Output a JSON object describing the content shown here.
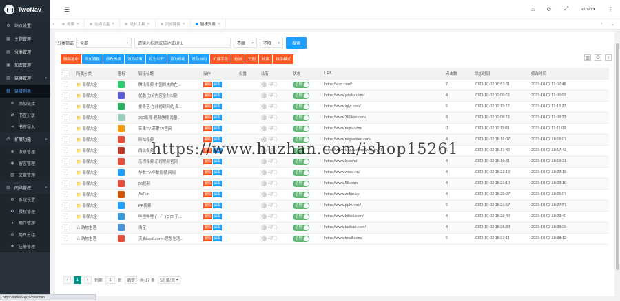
{
  "app": {
    "name": "TwoNav"
  },
  "sidebar": {
    "items": [
      {
        "label": "站点设置",
        "icon": "gear-icon",
        "kind": "group",
        "glyph": "⚙"
      },
      {
        "label": "主题管理",
        "icon": "theme-icon",
        "kind": "group",
        "glyph": "▦"
      },
      {
        "label": "分类管理",
        "icon": "category-icon",
        "kind": "group",
        "glyph": "▤"
      },
      {
        "label": "加密管理",
        "icon": "lock-icon",
        "kind": "group",
        "glyph": "▣"
      },
      {
        "label": "链接管理",
        "icon": "link-icon",
        "kind": "group",
        "glyph": "▥",
        "caret": true
      },
      {
        "label": "链接列表",
        "icon": "list-icon",
        "kind": "active",
        "glyph": "⛓"
      },
      {
        "label": "添加链接",
        "icon": "plus-icon",
        "kind": "sub",
        "glyph": "⊕"
      },
      {
        "label": "书签分享",
        "icon": "share-icon",
        "kind": "sub",
        "glyph": "⇄"
      },
      {
        "label": "书签导入",
        "icon": "import-icon",
        "kind": "sub",
        "glyph": "⇥"
      },
      {
        "label": "扩展功能",
        "icon": "extension-icon",
        "kind": "group",
        "glyph": "☍",
        "caret": true
      },
      {
        "label": "收录管理",
        "icon": "collect-icon",
        "kind": "sub",
        "glyph": "◈"
      },
      {
        "label": "留言管理",
        "icon": "message-icon",
        "kind": "sub",
        "glyph": "◉"
      },
      {
        "label": "文章管理",
        "icon": "article-icon",
        "kind": "sub",
        "glyph": "▧"
      },
      {
        "label": "网站管理",
        "icon": "website-icon",
        "kind": "group",
        "glyph": "▨",
        "caret": true
      },
      {
        "label": "系统设置",
        "icon": "settings-icon",
        "kind": "sub",
        "glyph": "⚙"
      },
      {
        "label": "授权管理",
        "icon": "license-icon",
        "kind": "sub",
        "glyph": "✪"
      },
      {
        "label": "用户管理",
        "icon": "user-icon",
        "kind": "sub",
        "glyph": "●"
      },
      {
        "label": "用户分组",
        "icon": "group-icon",
        "kind": "sub",
        "glyph": "◍"
      },
      {
        "label": "注册管理",
        "icon": "register-icon",
        "kind": "sub",
        "glyph": "✚"
      }
    ]
  },
  "topbar": {
    "user": "admin"
  },
  "tabs": [
    {
      "label": "概要",
      "active": false
    },
    {
      "label": "站点设置",
      "active": false
    },
    {
      "label": "站长工具",
      "active": false
    },
    {
      "label": "添加链接",
      "active": false
    },
    {
      "label": "链接列表",
      "active": true
    }
  ],
  "filter": {
    "category_label": "分类筛选",
    "category_value": "全部",
    "search_placeholder": "请输入标题或描述或URL",
    "select2": "不限",
    "select3": "不限",
    "search_button": "搜索"
  },
  "toolbar": [
    {
      "label": "删除选中",
      "color": "red"
    },
    {
      "label": "添加链接",
      "color": "blue"
    },
    {
      "label": "修改分类",
      "color": "blue"
    },
    {
      "label": "设为私有",
      "color": "blue"
    },
    {
      "label": "设为公开",
      "color": "blue"
    },
    {
      "label": "设为停用",
      "color": "blue"
    },
    {
      "label": "设为启用",
      "color": "blue"
    },
    {
      "label": "扩展字段",
      "color": "red"
    },
    {
      "label": "检测",
      "color": "red"
    },
    {
      "label": "识别",
      "color": "red"
    },
    {
      "label": "排序",
      "color": "red"
    },
    {
      "label": "排序模式",
      "color": "red"
    }
  ],
  "table": {
    "headers": [
      "",
      "所属分类",
      "图标",
      "链接标题",
      "操作",
      "权重",
      "私有",
      "状态",
      "URL",
      "点击数",
      "添加时间",
      "修改时间"
    ],
    "delete_label": "删除",
    "edit_label": "编辑",
    "private_label": "公开",
    "status_label": "启用",
    "rows": [
      {
        "category": "影视大全",
        "cat_icon": "📁",
        "fav": "#2ecc71",
        "title": "腾讯视频-中国领先的在...",
        "weight": "",
        "url": "https://v.qq.com/",
        "clicks": "7",
        "added": "2023-10-02 10:53:31",
        "modified": "2023-10-02 11:02:48"
      },
      {
        "category": "影视大全",
        "cat_icon": "📁",
        "fav": "#5b5bd6",
        "title": "优酷-为好内容全力以赴",
        "weight": "",
        "url": "https://www.youku.com/",
        "clicks": "4",
        "added": "2023-10-02 11:06:03",
        "modified": "2023-10-02 11:06:03"
      },
      {
        "category": "影视大全",
        "cat_icon": "📁",
        "fav": "#27ae60",
        "title": "爱奇艺-在线视频网站-海...",
        "weight": "",
        "url": "https://www.iqiyi.com/",
        "clicks": "5",
        "added": "2023-10-02 11:13:27",
        "modified": "2023-10-02 11:13:27"
      },
      {
        "category": "影视大全",
        "cat_icon": "📁",
        "fav": "#9acfc0",
        "title": "360影视-视频快搜,海量...",
        "weight": "",
        "url": "https://www.360kan.com/",
        "clicks": "8",
        "added": "2023-10-02 11:08:23",
        "modified": "2023-10-02 11:08:23"
      },
      {
        "category": "影视大全",
        "cat_icon": "📁",
        "fav": "#f39c12",
        "title": "芒果TV-芒果TV官网",
        "weight": "",
        "url": "https://www.mgtv.com/",
        "clicks": "0",
        "added": "2023-10-02 11:11:09",
        "modified": "2023-10-02 11:11:09"
      },
      {
        "category": "影视大全",
        "cat_icon": "📁",
        "fav": "#e74c3c",
        "title": "咪咕视频",
        "weight": "",
        "url": "https://www.miguvideo.com/",
        "clicks": "4",
        "added": "2023-10-02 18:16:07",
        "modified": "2023-10-02 18:16:07"
      },
      {
        "category": "影视大全",
        "cat_icon": "📁",
        "fav": "#c0392b",
        "title": "西瓜视频",
        "weight": "",
        "url": "https://www.ixigua.com/?wid_try=1",
        "clicks": "5",
        "added": "2023-10-02 18:17:43",
        "modified": "2023-10-02 18:17:43"
      },
      {
        "category": "影视大全",
        "cat_icon": "📁",
        "fav": "#e74c3c",
        "title": "乐视视频-乐视视频官网",
        "weight": "",
        "url": "https://www.le.com/",
        "clicks": "4",
        "added": "2023-10-02 18:19:31",
        "modified": "2023-10-02 18:19:31"
      },
      {
        "category": "影视大全",
        "cat_icon": "📁",
        "fav": "#1e9fff",
        "title": "华数TV-华数影视 网络",
        "weight": "",
        "url": "https://www.wasu.cn/",
        "clicks": "4",
        "added": "2023-10-02 18:22:19",
        "modified": "2023-10-02 18:22:19"
      },
      {
        "category": "影视大全",
        "cat_icon": "📁",
        "fav": "#e74c3c",
        "title": "56视频",
        "weight": "",
        "url": "https://www.56.com/",
        "clicks": "4",
        "added": "2023-10-02 18:23:10",
        "modified": "2023-10-02 18:23:10"
      },
      {
        "category": "影视大全",
        "cat_icon": "📁",
        "fav": "#d35400",
        "title": "AcFun",
        "weight": "",
        "url": "https://www.acfun.cn/",
        "clicks": "4",
        "added": "2023-10-02 18:25:07",
        "modified": "2023-10-02 18:25:07"
      },
      {
        "category": "影视大全",
        "cat_icon": "📁",
        "fav": "#1e9fff",
        "title": "PP视频",
        "weight": "",
        "url": "https://www.pptv.com/",
        "clicks": "5",
        "added": "2023-10-02 18:27:57",
        "modified": "2023-10-02 18:27:57"
      },
      {
        "category": "影视大全",
        "cat_icon": "📁",
        "fav": "#3498db",
        "title": "哔哩哔哩 (゜-゜)つロ 干...",
        "weight": "",
        "url": "https://www.bilibili.com/",
        "clicks": "4",
        "added": "2023-10-02 18:29:40",
        "modified": "2023-10-02 18:29:40"
      },
      {
        "category": "购物生活",
        "cat_icon": "☆",
        "fav": "#4a90d9",
        "title": "淘宝",
        "weight": "",
        "url": "https://www.taobao.com/",
        "clicks": "4",
        "added": "2023-10-02 18:35:39",
        "modified": "2023-10-02 18:35:39"
      },
      {
        "category": "购物生活",
        "cat_icon": "☆",
        "fav": "#e74c3c",
        "title": "天猫tmall.com--理想生活...",
        "weight": "",
        "url": "https://www.tmall.com/",
        "clicks": "5",
        "added": "2023-10-02 18:37:11",
        "modified": "2023-10-02 18:38:12"
      }
    ]
  },
  "pager": {
    "prev": "‹",
    "current": "1",
    "next": "›",
    "goto_label": "到第",
    "page_value": "1",
    "page_unit": "页",
    "confirm": "确定",
    "total": "共 17 条",
    "per_page": "50 条/页"
  },
  "statusbar": {
    "text": "https://88666.xyz/?c=admin"
  },
  "watermark": {
    "text": "https://www.huzhan.com/ishop15261"
  }
}
